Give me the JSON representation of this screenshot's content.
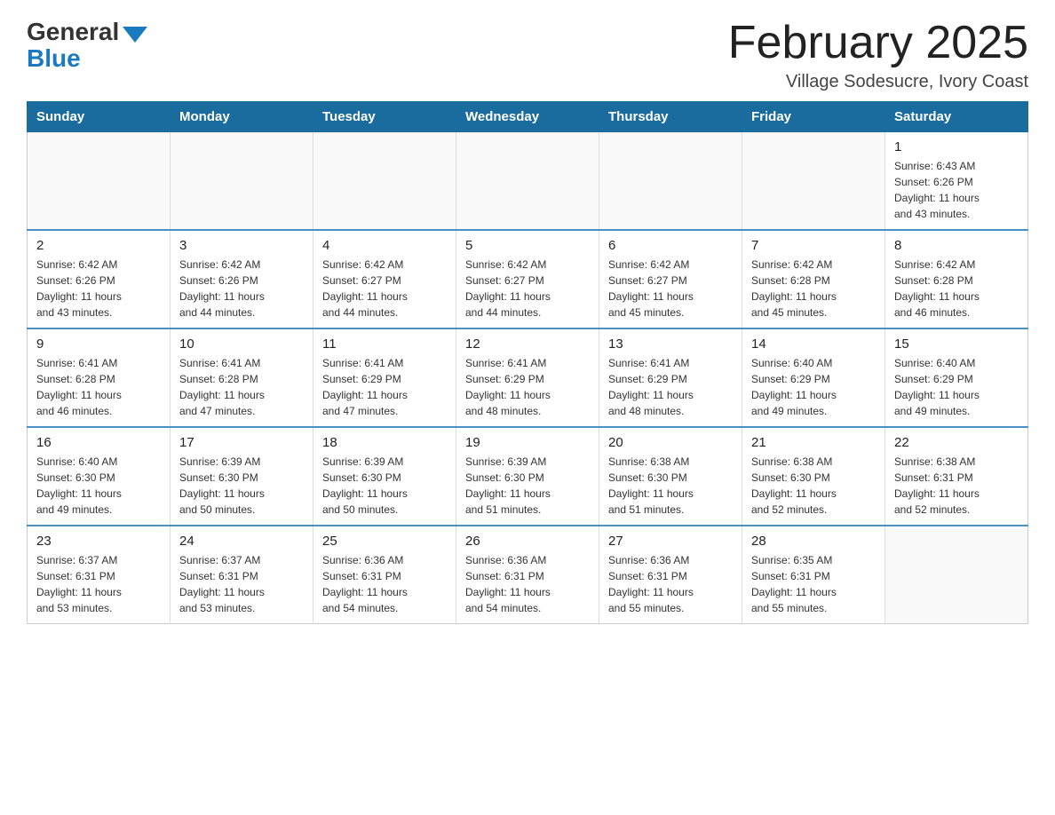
{
  "header": {
    "logo_general": "General",
    "logo_blue": "Blue",
    "month_title": "February 2025",
    "subtitle": "Village Sodesucre, Ivory Coast"
  },
  "days_of_week": [
    "Sunday",
    "Monday",
    "Tuesday",
    "Wednesday",
    "Thursday",
    "Friday",
    "Saturday"
  ],
  "weeks": [
    [
      {
        "day": "",
        "info": ""
      },
      {
        "day": "",
        "info": ""
      },
      {
        "day": "",
        "info": ""
      },
      {
        "day": "",
        "info": ""
      },
      {
        "day": "",
        "info": ""
      },
      {
        "day": "",
        "info": ""
      },
      {
        "day": "1",
        "info": "Sunrise: 6:43 AM\nSunset: 6:26 PM\nDaylight: 11 hours\nand 43 minutes."
      }
    ],
    [
      {
        "day": "2",
        "info": "Sunrise: 6:42 AM\nSunset: 6:26 PM\nDaylight: 11 hours\nand 43 minutes."
      },
      {
        "day": "3",
        "info": "Sunrise: 6:42 AM\nSunset: 6:26 PM\nDaylight: 11 hours\nand 44 minutes."
      },
      {
        "day": "4",
        "info": "Sunrise: 6:42 AM\nSunset: 6:27 PM\nDaylight: 11 hours\nand 44 minutes."
      },
      {
        "day": "5",
        "info": "Sunrise: 6:42 AM\nSunset: 6:27 PM\nDaylight: 11 hours\nand 44 minutes."
      },
      {
        "day": "6",
        "info": "Sunrise: 6:42 AM\nSunset: 6:27 PM\nDaylight: 11 hours\nand 45 minutes."
      },
      {
        "day": "7",
        "info": "Sunrise: 6:42 AM\nSunset: 6:28 PM\nDaylight: 11 hours\nand 45 minutes."
      },
      {
        "day": "8",
        "info": "Sunrise: 6:42 AM\nSunset: 6:28 PM\nDaylight: 11 hours\nand 46 minutes."
      }
    ],
    [
      {
        "day": "9",
        "info": "Sunrise: 6:41 AM\nSunset: 6:28 PM\nDaylight: 11 hours\nand 46 minutes."
      },
      {
        "day": "10",
        "info": "Sunrise: 6:41 AM\nSunset: 6:28 PM\nDaylight: 11 hours\nand 47 minutes."
      },
      {
        "day": "11",
        "info": "Sunrise: 6:41 AM\nSunset: 6:29 PM\nDaylight: 11 hours\nand 47 minutes."
      },
      {
        "day": "12",
        "info": "Sunrise: 6:41 AM\nSunset: 6:29 PM\nDaylight: 11 hours\nand 48 minutes."
      },
      {
        "day": "13",
        "info": "Sunrise: 6:41 AM\nSunset: 6:29 PM\nDaylight: 11 hours\nand 48 minutes."
      },
      {
        "day": "14",
        "info": "Sunrise: 6:40 AM\nSunset: 6:29 PM\nDaylight: 11 hours\nand 49 minutes."
      },
      {
        "day": "15",
        "info": "Sunrise: 6:40 AM\nSunset: 6:29 PM\nDaylight: 11 hours\nand 49 minutes."
      }
    ],
    [
      {
        "day": "16",
        "info": "Sunrise: 6:40 AM\nSunset: 6:30 PM\nDaylight: 11 hours\nand 49 minutes."
      },
      {
        "day": "17",
        "info": "Sunrise: 6:39 AM\nSunset: 6:30 PM\nDaylight: 11 hours\nand 50 minutes."
      },
      {
        "day": "18",
        "info": "Sunrise: 6:39 AM\nSunset: 6:30 PM\nDaylight: 11 hours\nand 50 minutes."
      },
      {
        "day": "19",
        "info": "Sunrise: 6:39 AM\nSunset: 6:30 PM\nDaylight: 11 hours\nand 51 minutes."
      },
      {
        "day": "20",
        "info": "Sunrise: 6:38 AM\nSunset: 6:30 PM\nDaylight: 11 hours\nand 51 minutes."
      },
      {
        "day": "21",
        "info": "Sunrise: 6:38 AM\nSunset: 6:30 PM\nDaylight: 11 hours\nand 52 minutes."
      },
      {
        "day": "22",
        "info": "Sunrise: 6:38 AM\nSunset: 6:31 PM\nDaylight: 11 hours\nand 52 minutes."
      }
    ],
    [
      {
        "day": "23",
        "info": "Sunrise: 6:37 AM\nSunset: 6:31 PM\nDaylight: 11 hours\nand 53 minutes."
      },
      {
        "day": "24",
        "info": "Sunrise: 6:37 AM\nSunset: 6:31 PM\nDaylight: 11 hours\nand 53 minutes."
      },
      {
        "day": "25",
        "info": "Sunrise: 6:36 AM\nSunset: 6:31 PM\nDaylight: 11 hours\nand 54 minutes."
      },
      {
        "day": "26",
        "info": "Sunrise: 6:36 AM\nSunset: 6:31 PM\nDaylight: 11 hours\nand 54 minutes."
      },
      {
        "day": "27",
        "info": "Sunrise: 6:36 AM\nSunset: 6:31 PM\nDaylight: 11 hours\nand 55 minutes."
      },
      {
        "day": "28",
        "info": "Sunrise: 6:35 AM\nSunset: 6:31 PM\nDaylight: 11 hours\nand 55 minutes."
      },
      {
        "day": "",
        "info": ""
      }
    ]
  ]
}
